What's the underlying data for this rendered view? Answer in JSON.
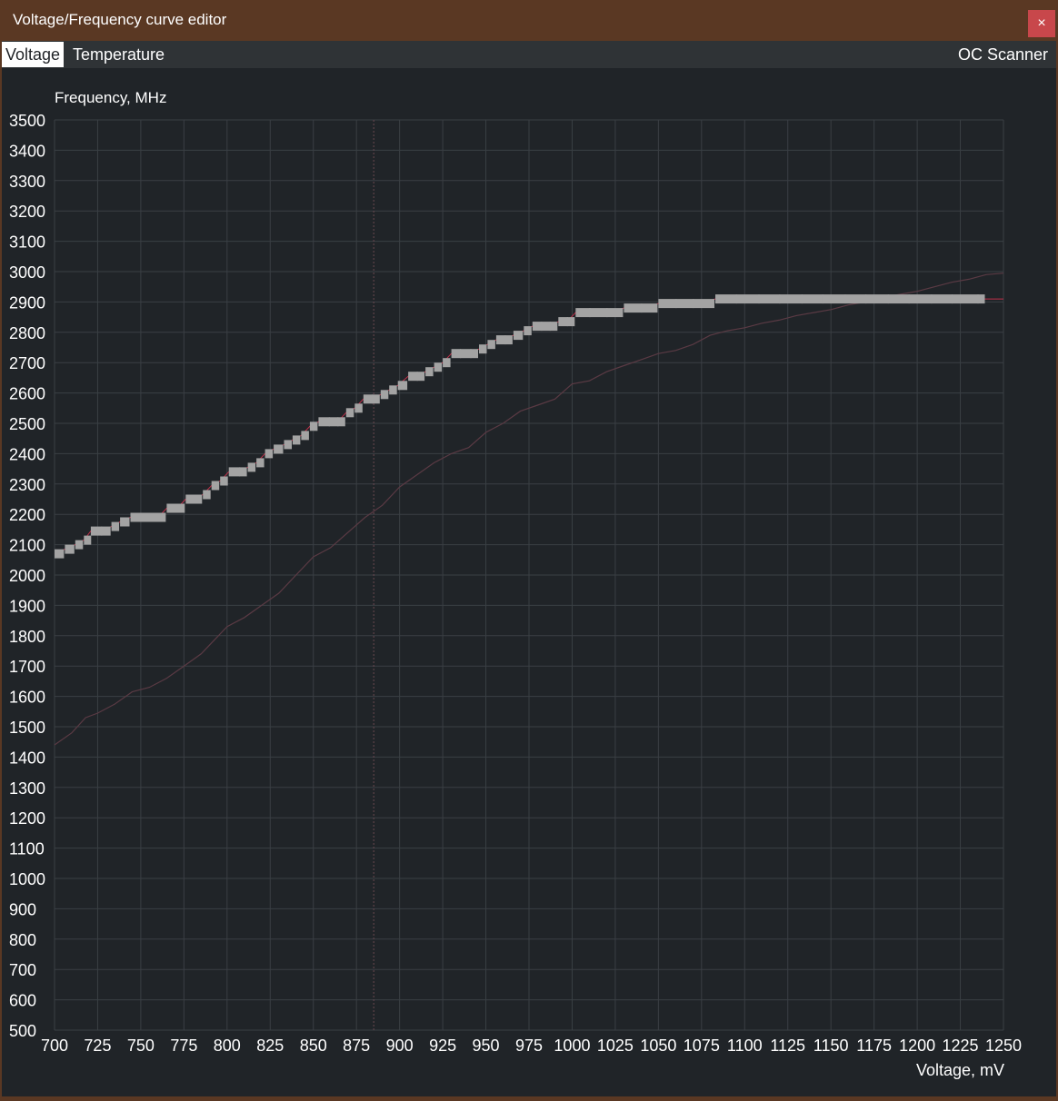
{
  "window": {
    "title": "Voltage/Frequency curve editor",
    "close_label": "×"
  },
  "tabs": [
    {
      "label": "Voltage",
      "active": true
    },
    {
      "label": "Temperature",
      "active": false
    }
  ],
  "oc_scanner_label": "OC Scanner",
  "colors": {
    "titlebar": "#5a3823",
    "close_button": "#c8474b",
    "plot_background": "#202428",
    "grid": "#3a3f44",
    "curve_points": "#a3a3a3",
    "curve_line": "#c0304a",
    "secondary_curve": "#5a3a44",
    "marker_line": "#6a4850"
  },
  "chart_data": {
    "type": "line",
    "ylabel": "Frequency, MHz",
    "xlabel": "Voltage, mV",
    "xlim": [
      700,
      1250
    ],
    "ylim": [
      500,
      3500
    ],
    "x_ticks": [
      "700",
      "725",
      "750",
      "775",
      "800",
      "825",
      "850",
      "875",
      "900",
      "925",
      "950",
      "975",
      "1000",
      "1025",
      "1050",
      "1075",
      "1100",
      "1125",
      "1150",
      "1175",
      "1200",
      "1225",
      "1250"
    ],
    "y_ticks": [
      "3500",
      "3400",
      "3300",
      "3200",
      "3100",
      "3000",
      "2900",
      "2800",
      "2700",
      "2600",
      "2500",
      "2400",
      "2300",
      "2200",
      "2100",
      "2000",
      "1900",
      "1800",
      "1700",
      "1600",
      "1500",
      "1400",
      "1300",
      "1200",
      "1100",
      "1000",
      "900",
      "800",
      "700",
      "600",
      "500"
    ],
    "grid": true,
    "marker_voltage": 885,
    "series": [
      {
        "role": "vf-curve-points",
        "points": [
          [
            700,
            2070
          ],
          [
            706,
            2085
          ],
          [
            712,
            2100
          ],
          [
            717,
            2115
          ],
          [
            721,
            2145
          ],
          [
            727,
            2145
          ],
          [
            733,
            2160
          ],
          [
            738,
            2175
          ],
          [
            744,
            2190
          ],
          [
            749,
            2190
          ],
          [
            754,
            2190
          ],
          [
            760,
            2190
          ],
          [
            765,
            2220
          ],
          [
            771,
            2220
          ],
          [
            776,
            2250
          ],
          [
            781,
            2250
          ],
          [
            786,
            2265
          ],
          [
            791,
            2295
          ],
          [
            796,
            2310
          ],
          [
            801,
            2340
          ],
          [
            807,
            2340
          ],
          [
            812,
            2355
          ],
          [
            817,
            2370
          ],
          [
            822,
            2400
          ],
          [
            827,
            2415
          ],
          [
            833,
            2430
          ],
          [
            838,
            2445
          ],
          [
            843,
            2460
          ],
          [
            848,
            2490
          ],
          [
            853,
            2505
          ],
          [
            859,
            2505
          ],
          [
            864,
            2505
          ],
          [
            869,
            2535
          ],
          [
            874,
            2550
          ],
          [
            879,
            2580
          ],
          [
            884,
            2580
          ],
          [
            889,
            2595
          ],
          [
            894,
            2610
          ],
          [
            899,
            2625
          ],
          [
            905,
            2655
          ],
          [
            910,
            2655
          ],
          [
            915,
            2670
          ],
          [
            920,
            2685
          ],
          [
            925,
            2700
          ],
          [
            930,
            2730
          ],
          [
            935,
            2730
          ],
          [
            941,
            2730
          ],
          [
            946,
            2745
          ],
          [
            951,
            2760
          ],
          [
            956,
            2775
          ],
          [
            961,
            2775
          ],
          [
            966,
            2790
          ],
          [
            972,
            2805
          ],
          [
            977,
            2820
          ],
          [
            982,
            2820
          ],
          [
            987,
            2820
          ],
          [
            992,
            2835
          ],
          [
            997,
            2835
          ],
          [
            1002,
            2865
          ],
          [
            1010,
            2865
          ],
          [
            1020,
            2865
          ],
          [
            1030,
            2880
          ],
          [
            1040,
            2880
          ],
          [
            1050,
            2895
          ],
          [
            1060,
            2895
          ],
          [
            1070,
            2895
          ],
          [
            1083,
            2910
          ],
          [
            1095,
            2910
          ],
          [
            1108,
            2910
          ],
          [
            1120,
            2910
          ],
          [
            1133,
            2910
          ],
          [
            1145,
            2910
          ],
          [
            1158,
            2910
          ],
          [
            1170,
            2910
          ],
          [
            1183,
            2910
          ],
          [
            1195,
            2910
          ],
          [
            1208,
            2910
          ],
          [
            1220,
            2910
          ],
          [
            1235,
            2910
          ]
        ]
      },
      {
        "role": "secondary-curve",
        "points": [
          [
            700,
            1440
          ],
          [
            710,
            1480
          ],
          [
            718,
            1530
          ],
          [
            725,
            1545
          ],
          [
            735,
            1575
          ],
          [
            745,
            1615
          ],
          [
            755,
            1630
          ],
          [
            765,
            1660
          ],
          [
            775,
            1700
          ],
          [
            785,
            1740
          ],
          [
            790,
            1770
          ],
          [
            800,
            1830
          ],
          [
            810,
            1860
          ],
          [
            820,
            1900
          ],
          [
            830,
            1940
          ],
          [
            840,
            2000
          ],
          [
            850,
            2060
          ],
          [
            860,
            2090
          ],
          [
            870,
            2140
          ],
          [
            880,
            2190
          ],
          [
            890,
            2230
          ],
          [
            900,
            2290
          ],
          [
            910,
            2330
          ],
          [
            920,
            2370
          ],
          [
            930,
            2400
          ],
          [
            940,
            2420
          ],
          [
            950,
            2470
          ],
          [
            960,
            2500
          ],
          [
            970,
            2540
          ],
          [
            980,
            2560
          ],
          [
            990,
            2580
          ],
          [
            1000,
            2630
          ],
          [
            1010,
            2640
          ],
          [
            1020,
            2670
          ],
          [
            1030,
            2690
          ],
          [
            1040,
            2710
          ],
          [
            1050,
            2730
          ],
          [
            1060,
            2740
          ],
          [
            1070,
            2760
          ],
          [
            1080,
            2790
          ],
          [
            1090,
            2805
          ],
          [
            1100,
            2815
          ],
          [
            1110,
            2830
          ],
          [
            1120,
            2840
          ],
          [
            1130,
            2855
          ],
          [
            1140,
            2865
          ],
          [
            1150,
            2875
          ],
          [
            1160,
            2890
          ],
          [
            1170,
            2900
          ],
          [
            1180,
            2915
          ],
          [
            1190,
            2925
          ],
          [
            1200,
            2935
          ],
          [
            1210,
            2950
          ],
          [
            1220,
            2965
          ],
          [
            1230,
            2975
          ],
          [
            1240,
            2990
          ],
          [
            1250,
            2995
          ]
        ]
      }
    ]
  }
}
